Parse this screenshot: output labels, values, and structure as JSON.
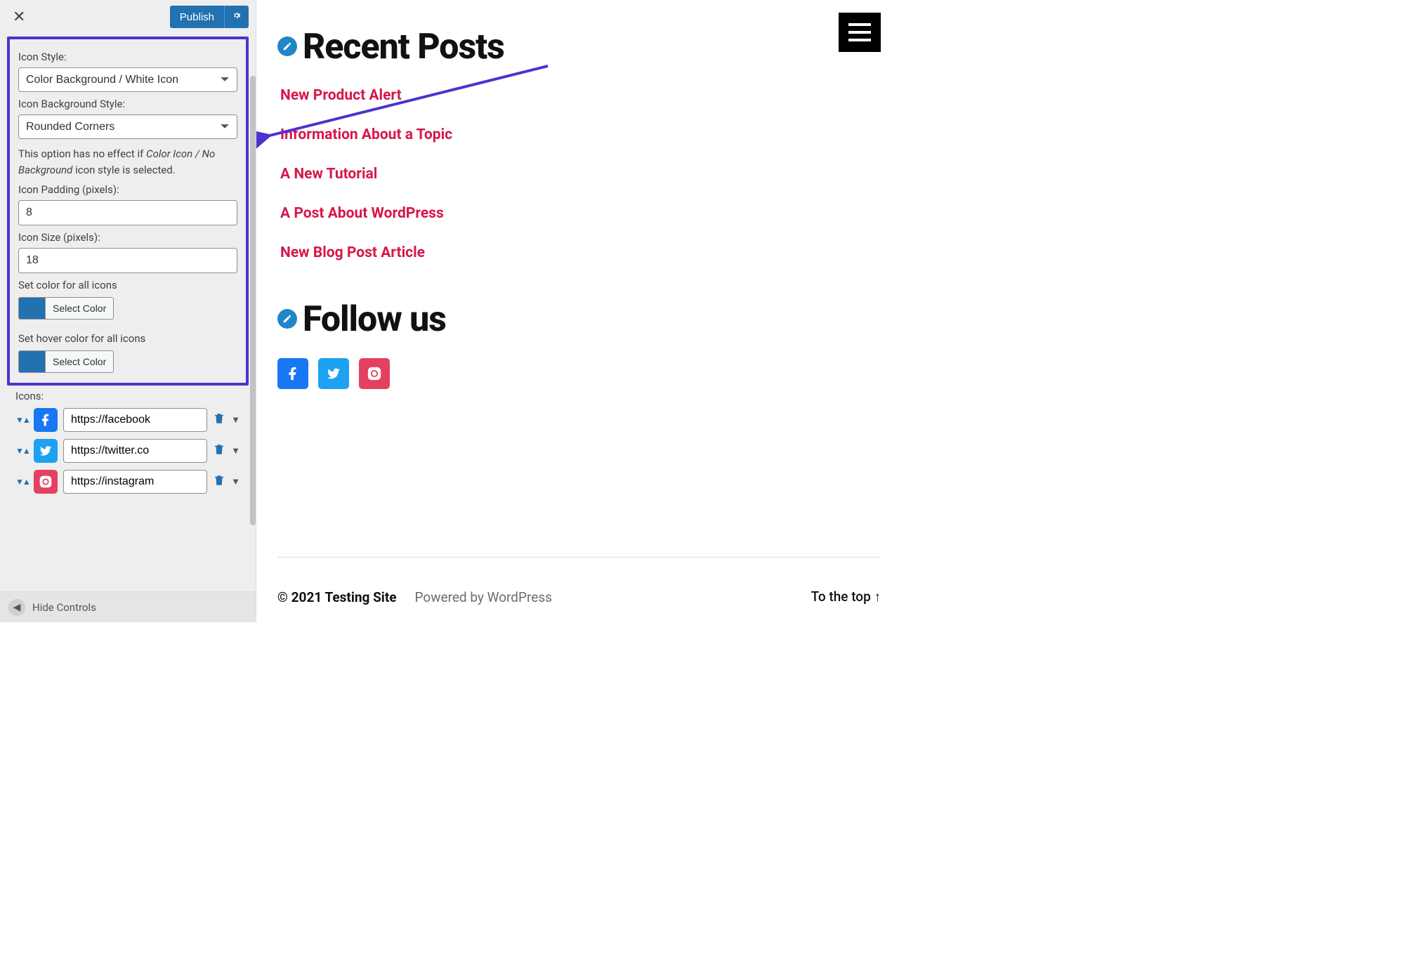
{
  "sidebar": {
    "publish_label": "Publish",
    "icon_style_label": "Icon Style:",
    "icon_style_value": "Color Background / White Icon",
    "icon_bg_label": "Icon Background Style:",
    "icon_bg_value": "Rounded Corners",
    "hint_prefix": "This option has no effect if ",
    "hint_italic": "Color Icon / No Background",
    "hint_suffix": " icon style is selected.",
    "padding_label": "Icon Padding (pixels):",
    "padding_value": "8",
    "size_label": "Icon Size (pixels):",
    "size_value": "18",
    "set_color_label": "Set color for all icons",
    "set_hover_label": "Set hover color for all icons",
    "select_color_btn": "Select Color",
    "icons_label": "Icons:",
    "icons": [
      {
        "platform": "facebook",
        "url": "https://facebook"
      },
      {
        "platform": "twitter",
        "url": "https://twitter.co"
      },
      {
        "platform": "instagram",
        "url": "https://instagram"
      }
    ],
    "hide_controls_label": "Hide Controls"
  },
  "preview": {
    "recent_title": "Recent Posts",
    "posts": [
      "New Product Alert",
      "Information About a Topic",
      "A New Tutorial",
      "A Post About WordPress",
      "New Blog Post Article"
    ],
    "follow_title": "Follow us",
    "footer_copy": "© 2021 Testing Site",
    "footer_powered": "Powered by WordPress",
    "footer_to_top": "To the top ↑"
  }
}
